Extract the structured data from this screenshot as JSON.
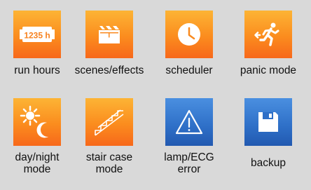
{
  "tiles": [
    {
      "label": "run hours",
      "icon": "run-hours-counter-icon",
      "icon_text": "1235 h",
      "color": "#f98a1f"
    },
    {
      "label": "scenes/effects",
      "icon": "clapperboard-icon",
      "color": "#f98a1f"
    },
    {
      "label": "scheduler",
      "icon": "clock-icon",
      "color": "#f98a1f"
    },
    {
      "label": "panic mode",
      "icon": "running-man-exit-icon",
      "color": "#f98a1f"
    },
    {
      "label": "day/night mode",
      "label_lines": [
        "day/night",
        "mode"
      ],
      "icon": "sun-moon-icon",
      "color": "#f98a1f"
    },
    {
      "label": "stair case mode",
      "label_lines": [
        "stair case",
        "mode"
      ],
      "icon": "staircase-icon",
      "color": "#f98a1f"
    },
    {
      "label": "lamp/ECG error",
      "label_lines": [
        "lamp/ECG",
        "error"
      ],
      "icon": "warning-triangle-icon",
      "color": "#2e6fc7"
    },
    {
      "label": "backup",
      "icon": "floppy-disk-icon",
      "color": "#2e6fc7"
    }
  ]
}
